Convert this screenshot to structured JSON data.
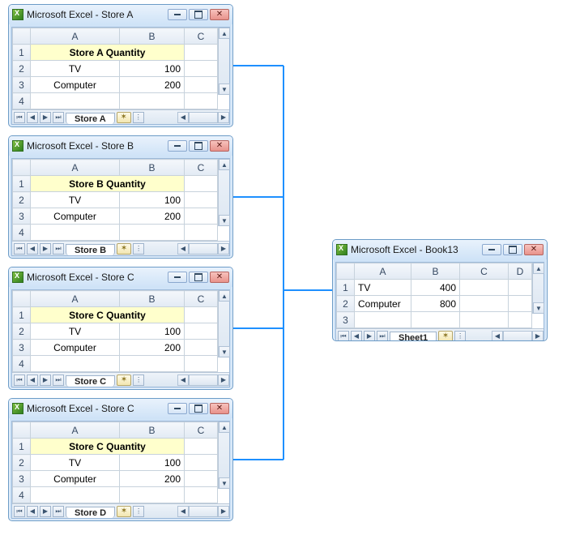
{
  "sources": [
    {
      "title": "Microsoft Excel - Store A",
      "merged_header": "Store A Quantity",
      "rows": [
        [
          "TV",
          "100"
        ],
        [
          "Computer",
          "200"
        ]
      ],
      "sheet_tab": "Store A"
    },
    {
      "title": "Microsoft Excel - Store B",
      "merged_header": "Store B Quantity",
      "rows": [
        [
          "TV",
          "100"
        ],
        [
          "Computer",
          "200"
        ]
      ],
      "sheet_tab": "Store B"
    },
    {
      "title": "Microsoft Excel - Store C",
      "merged_header": "Store C Quantity",
      "rows": [
        [
          "TV",
          "100"
        ],
        [
          "Computer",
          "200"
        ]
      ],
      "sheet_tab": "Store C"
    },
    {
      "title": "Microsoft Excel - Store C",
      "merged_header": "Store C Quantity",
      "rows": [
        [
          "TV",
          "100"
        ],
        [
          "Computer",
          "200"
        ]
      ],
      "sheet_tab": "Store D"
    }
  ],
  "dest": {
    "title": "Microsoft Excel - Book13",
    "rows": [
      [
        "TV",
        "400"
      ],
      [
        "Computer",
        "800"
      ]
    ],
    "sheet_tab": "Sheet1"
  },
  "col_letters": [
    "A",
    "B",
    "C",
    "D"
  ],
  "nav_glyphs": {
    "first": "⏮",
    "prev": "◀",
    "next": "▶",
    "last": "⏭",
    "up": "▲",
    "down": "▼",
    "new": "✶",
    "sep": "⋮"
  }
}
